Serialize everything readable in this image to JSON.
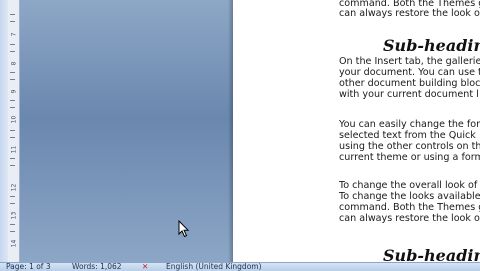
{
  "ruler": {
    "numbers": [
      "7",
      "8",
      "9",
      "10",
      "11",
      "12",
      "13",
      "14"
    ]
  },
  "document": {
    "top_lines": [
      "command. Both the Themes ga",
      "can always restore the look o"
    ],
    "heading_1": "Sub-heading",
    "paragraph_1": [
      "On the Insert tab, the gallerie",
      "your document.  You can use t",
      "other document building block",
      "with your current document l"
    ],
    "paragraph_2": [
      "You can easily change the for",
      "selected text from the Quick",
      "using the other controls on th",
      "current theme or using a form"
    ],
    "paragraph_3": [
      "To change the overall look of",
      "To change the looks available",
      "command. Both the Themes g",
      "can always restore the look o"
    ],
    "heading_2": "Sub-heading"
  },
  "statusbar": {
    "page": "Page: 1 of 3",
    "words": "Words: 1,062",
    "language": "English (United Kingdom)"
  },
  "colors": {
    "workspace": "#6a87ae",
    "statusbar": "#c9dbf0"
  }
}
